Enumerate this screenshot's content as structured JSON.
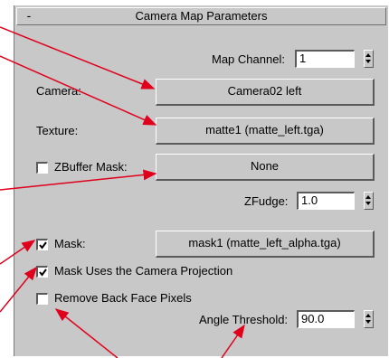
{
  "rollout": {
    "collapse_symbol": "-",
    "title": "Camera Map Parameters"
  },
  "map_channel": {
    "label": "Map Channel:",
    "value": "1"
  },
  "camera": {
    "label": "Camera:",
    "button": "Camera02 left"
  },
  "texture": {
    "label": "Texture:",
    "button": "matte1 (matte_left.tga)"
  },
  "zbuffer_mask": {
    "label": "ZBuffer Mask:",
    "checked": false,
    "button": "None"
  },
  "zfudge": {
    "label": "ZFudge:",
    "value": "1.0"
  },
  "mask": {
    "label": "Mask:",
    "checked": true,
    "button": "mask1 (matte_left_alpha.tga)"
  },
  "mask_uses_camera_projection": {
    "label": "Mask Uses the Camera Projection",
    "checked": true
  },
  "remove_back_face_pixels": {
    "label": "Remove Back Face Pixels",
    "checked": false
  },
  "angle_threshold": {
    "label": "Angle Threshold:",
    "value": "90.0"
  },
  "annotation_arrow_color": "#e0001b",
  "icons": {
    "spinner": "spinner-arrows-icon",
    "check": "checkmark-icon",
    "collapse": "minus-icon"
  }
}
